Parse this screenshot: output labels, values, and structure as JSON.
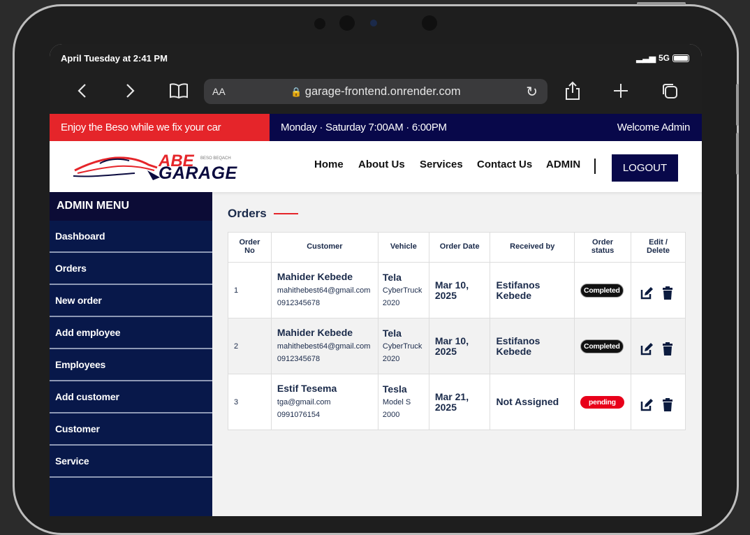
{
  "status_bar": {
    "time": "April Tuesday at 2:41 PM",
    "signal": "5G"
  },
  "browser": {
    "text_size": "AA",
    "url": "garage-frontend.onrender.com"
  },
  "topbar": {
    "promo": "Enjoy the Beso while we fix your car",
    "hours": "Monday · Saturday 7:00AM · 6:00PM",
    "welcome": "Welcome Admin"
  },
  "logo": {
    "line1": "ABE",
    "line2": "GARAGE",
    "tagline": "BESO BEQACH"
  },
  "nav": {
    "home": "Home",
    "about": "About Us",
    "services": "Services",
    "contact": "Contact Us",
    "admin": "ADMIN",
    "logout": "LOGOUT"
  },
  "sidebar": {
    "title": "ADMIN MENU",
    "items": [
      {
        "label": "Dashboard"
      },
      {
        "label": "Orders"
      },
      {
        "label": "New order"
      },
      {
        "label": "Add employee"
      },
      {
        "label": "Employees"
      },
      {
        "label": "Add customer"
      },
      {
        "label": "Customer"
      },
      {
        "label": "Service"
      }
    ]
  },
  "orders": {
    "title": "Orders",
    "headers": {
      "no": "Order No",
      "customer": "Customer",
      "vehicle": "Vehicle",
      "date": "Order Date",
      "received": "Received by",
      "status": "Order status",
      "actions": "Edit / Delete"
    },
    "rows": [
      {
        "no": "1",
        "name": "Mahider Kebede",
        "email": "mahithebest64@gmail.com",
        "phone": "0912345678",
        "make": "Tela",
        "model": "CyberTruck",
        "year": "2020",
        "date": "Mar 10, 2025",
        "received": "Estifanos Kebede",
        "status": "Completed"
      },
      {
        "no": "2",
        "name": "Mahider Kebede",
        "email": "mahithebest64@gmail.com",
        "phone": "0912345678",
        "make": "Tela",
        "model": "CyberTruck",
        "year": "2020",
        "date": "Mar 10, 2025",
        "received": "Estifanos Kebede",
        "status": "Completed"
      },
      {
        "no": "3",
        "name": "Estif Tesema",
        "email": "tga@gmail.com",
        "phone": "0991076154",
        "make": "Tesla",
        "model": "Model S",
        "year": "2000",
        "date": "Mar 21, 2025",
        "received": "Not Assigned",
        "status": "pending"
      }
    ]
  },
  "colors": {
    "brand_red": "#e5252a",
    "brand_navy": "#08084a",
    "sidebar": "#08184a"
  },
  "icons": {
    "edit": "edit-icon",
    "delete": "trash-icon"
  }
}
